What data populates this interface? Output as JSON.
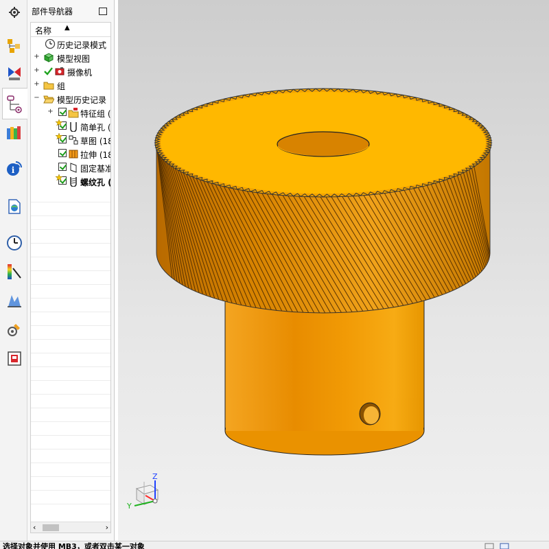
{
  "navigator": {
    "title": "部件导航器",
    "column_header": "名称",
    "sort_indicator": "▲",
    "items": [
      {
        "label": "历史记录模式",
        "expander": ""
      },
      {
        "label": "模型视图",
        "expander": "+"
      },
      {
        "label": "摄像机",
        "expander": "+"
      },
      {
        "label": "组",
        "expander": "+"
      },
      {
        "label": "模型历史记录",
        "expander": "−"
      },
      {
        "label": "特征组 (",
        "expander": "+"
      },
      {
        "label": "简单孔 (",
        "expander": ""
      },
      {
        "label": "草图 (18",
        "expander": ""
      },
      {
        "label": "拉伸 (18",
        "expander": ""
      },
      {
        "label": "固定基准",
        "expander": ""
      },
      {
        "label": "螺纹孔 (",
        "expander": ""
      }
    ]
  },
  "viewport": {
    "triad": {
      "z_label": "Z",
      "y_label": "Y"
    },
    "colors": {
      "gear_top": "#ffb800",
      "gear_teeth": "#e79300",
      "cylinder": "#f19a05"
    }
  },
  "status_bar": {
    "message": "选择对象并使用 MB3，或者双击某一对象"
  },
  "rail_icons": [
    "settings-gear-icon",
    "assembly-navigator-icon",
    "constraint-navigator-icon",
    "part-navigator-icon",
    "reuse-library-icon",
    "info-icon",
    "web-browser-icon",
    "history-icon",
    "visualization-icon",
    "analysis-icon",
    "process-studio-icon",
    "roles-icon"
  ]
}
